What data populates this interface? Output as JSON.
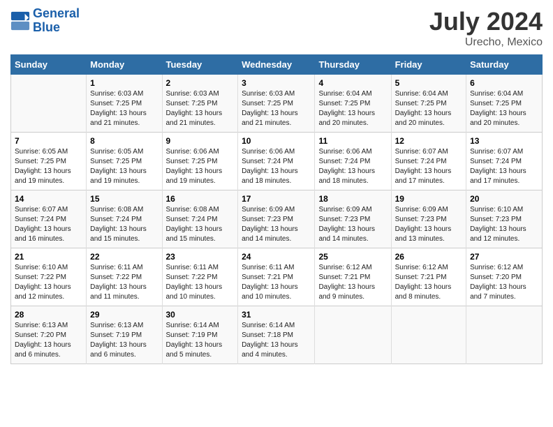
{
  "header": {
    "logo_line1": "General",
    "logo_line2": "Blue",
    "month": "July 2024",
    "location": "Urecho, Mexico"
  },
  "weekdays": [
    "Sunday",
    "Monday",
    "Tuesday",
    "Wednesday",
    "Thursday",
    "Friday",
    "Saturday"
  ],
  "weeks": [
    [
      {
        "day": "",
        "sunrise": "",
        "sunset": "",
        "daylight": ""
      },
      {
        "day": "1",
        "sunrise": "Sunrise: 6:03 AM",
        "sunset": "Sunset: 7:25 PM",
        "daylight": "Daylight: 13 hours and 21 minutes."
      },
      {
        "day": "2",
        "sunrise": "Sunrise: 6:03 AM",
        "sunset": "Sunset: 7:25 PM",
        "daylight": "Daylight: 13 hours and 21 minutes."
      },
      {
        "day": "3",
        "sunrise": "Sunrise: 6:03 AM",
        "sunset": "Sunset: 7:25 PM",
        "daylight": "Daylight: 13 hours and 21 minutes."
      },
      {
        "day": "4",
        "sunrise": "Sunrise: 6:04 AM",
        "sunset": "Sunset: 7:25 PM",
        "daylight": "Daylight: 13 hours and 20 minutes."
      },
      {
        "day": "5",
        "sunrise": "Sunrise: 6:04 AM",
        "sunset": "Sunset: 7:25 PM",
        "daylight": "Daylight: 13 hours and 20 minutes."
      },
      {
        "day": "6",
        "sunrise": "Sunrise: 6:04 AM",
        "sunset": "Sunset: 7:25 PM",
        "daylight": "Daylight: 13 hours and 20 minutes."
      }
    ],
    [
      {
        "day": "7",
        "sunrise": "Sunrise: 6:05 AM",
        "sunset": "Sunset: 7:25 PM",
        "daylight": "Daylight: 13 hours and 19 minutes."
      },
      {
        "day": "8",
        "sunrise": "Sunrise: 6:05 AM",
        "sunset": "Sunset: 7:25 PM",
        "daylight": "Daylight: 13 hours and 19 minutes."
      },
      {
        "day": "9",
        "sunrise": "Sunrise: 6:06 AM",
        "sunset": "Sunset: 7:25 PM",
        "daylight": "Daylight: 13 hours and 19 minutes."
      },
      {
        "day": "10",
        "sunrise": "Sunrise: 6:06 AM",
        "sunset": "Sunset: 7:24 PM",
        "daylight": "Daylight: 13 hours and 18 minutes."
      },
      {
        "day": "11",
        "sunrise": "Sunrise: 6:06 AM",
        "sunset": "Sunset: 7:24 PM",
        "daylight": "Daylight: 13 hours and 18 minutes."
      },
      {
        "day": "12",
        "sunrise": "Sunrise: 6:07 AM",
        "sunset": "Sunset: 7:24 PM",
        "daylight": "Daylight: 13 hours and 17 minutes."
      },
      {
        "day": "13",
        "sunrise": "Sunrise: 6:07 AM",
        "sunset": "Sunset: 7:24 PM",
        "daylight": "Daylight: 13 hours and 17 minutes."
      }
    ],
    [
      {
        "day": "14",
        "sunrise": "Sunrise: 6:07 AM",
        "sunset": "Sunset: 7:24 PM",
        "daylight": "Daylight: 13 hours and 16 minutes."
      },
      {
        "day": "15",
        "sunrise": "Sunrise: 6:08 AM",
        "sunset": "Sunset: 7:24 PM",
        "daylight": "Daylight: 13 hours and 15 minutes."
      },
      {
        "day": "16",
        "sunrise": "Sunrise: 6:08 AM",
        "sunset": "Sunset: 7:24 PM",
        "daylight": "Daylight: 13 hours and 15 minutes."
      },
      {
        "day": "17",
        "sunrise": "Sunrise: 6:09 AM",
        "sunset": "Sunset: 7:23 PM",
        "daylight": "Daylight: 13 hours and 14 minutes."
      },
      {
        "day": "18",
        "sunrise": "Sunrise: 6:09 AM",
        "sunset": "Sunset: 7:23 PM",
        "daylight": "Daylight: 13 hours and 14 minutes."
      },
      {
        "day": "19",
        "sunrise": "Sunrise: 6:09 AM",
        "sunset": "Sunset: 7:23 PM",
        "daylight": "Daylight: 13 hours and 13 minutes."
      },
      {
        "day": "20",
        "sunrise": "Sunrise: 6:10 AM",
        "sunset": "Sunset: 7:23 PM",
        "daylight": "Daylight: 13 hours and 12 minutes."
      }
    ],
    [
      {
        "day": "21",
        "sunrise": "Sunrise: 6:10 AM",
        "sunset": "Sunset: 7:22 PM",
        "daylight": "Daylight: 13 hours and 12 minutes."
      },
      {
        "day": "22",
        "sunrise": "Sunrise: 6:11 AM",
        "sunset": "Sunset: 7:22 PM",
        "daylight": "Daylight: 13 hours and 11 minutes."
      },
      {
        "day": "23",
        "sunrise": "Sunrise: 6:11 AM",
        "sunset": "Sunset: 7:22 PM",
        "daylight": "Daylight: 13 hours and 10 minutes."
      },
      {
        "day": "24",
        "sunrise": "Sunrise: 6:11 AM",
        "sunset": "Sunset: 7:21 PM",
        "daylight": "Daylight: 13 hours and 10 minutes."
      },
      {
        "day": "25",
        "sunrise": "Sunrise: 6:12 AM",
        "sunset": "Sunset: 7:21 PM",
        "daylight": "Daylight: 13 hours and 9 minutes."
      },
      {
        "day": "26",
        "sunrise": "Sunrise: 6:12 AM",
        "sunset": "Sunset: 7:21 PM",
        "daylight": "Daylight: 13 hours and 8 minutes."
      },
      {
        "day": "27",
        "sunrise": "Sunrise: 6:12 AM",
        "sunset": "Sunset: 7:20 PM",
        "daylight": "Daylight: 13 hours and 7 minutes."
      }
    ],
    [
      {
        "day": "28",
        "sunrise": "Sunrise: 6:13 AM",
        "sunset": "Sunset: 7:20 PM",
        "daylight": "Daylight: 13 hours and 6 minutes."
      },
      {
        "day": "29",
        "sunrise": "Sunrise: 6:13 AM",
        "sunset": "Sunset: 7:19 PM",
        "daylight": "Daylight: 13 hours and 6 minutes."
      },
      {
        "day": "30",
        "sunrise": "Sunrise: 6:14 AM",
        "sunset": "Sunset: 7:19 PM",
        "daylight": "Daylight: 13 hours and 5 minutes."
      },
      {
        "day": "31",
        "sunrise": "Sunrise: 6:14 AM",
        "sunset": "Sunset: 7:18 PM",
        "daylight": "Daylight: 13 hours and 4 minutes."
      },
      {
        "day": "",
        "sunrise": "",
        "sunset": "",
        "daylight": ""
      },
      {
        "day": "",
        "sunrise": "",
        "sunset": "",
        "daylight": ""
      },
      {
        "day": "",
        "sunrise": "",
        "sunset": "",
        "daylight": ""
      }
    ]
  ]
}
